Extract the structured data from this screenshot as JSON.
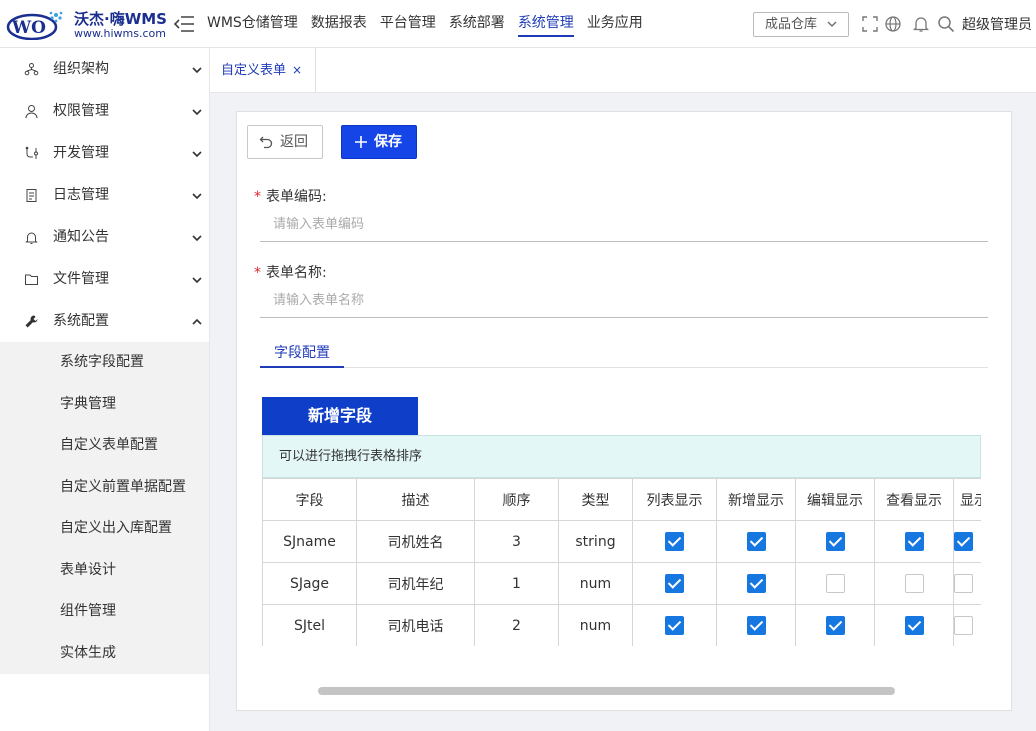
{
  "header": {
    "logo_title": "沃杰·嗨WMS",
    "logo_url": "www.hiwms.com",
    "nav": [
      {
        "label": "WMS仓储管理"
      },
      {
        "label": "数据报表"
      },
      {
        "label": "平台管理"
      },
      {
        "label": "系统部署"
      },
      {
        "label": "系统管理",
        "active": true
      },
      {
        "label": "业务应用"
      }
    ],
    "warehouse": "成品仓库",
    "user": "超级管理员"
  },
  "sidebar": {
    "items": [
      {
        "label": "组织架构",
        "icon": "org-icon",
        "expanded": false
      },
      {
        "label": "权限管理",
        "icon": "user-icon",
        "expanded": false
      },
      {
        "label": "开发管理",
        "icon": "dev-icon",
        "expanded": false
      },
      {
        "label": "日志管理",
        "icon": "log-icon",
        "expanded": false
      },
      {
        "label": "通知公告",
        "icon": "bell-icon",
        "expanded": false
      },
      {
        "label": "文件管理",
        "icon": "folder-icon",
        "expanded": false
      },
      {
        "label": "系统配置",
        "icon": "wrench-icon",
        "expanded": true
      }
    ],
    "subitems": [
      {
        "label": "系统字段配置"
      },
      {
        "label": "字典管理"
      },
      {
        "label": "自定义表单配置"
      },
      {
        "label": "自定义前置单据配置"
      },
      {
        "label": "自定义出入库配置"
      },
      {
        "label": "表单设计"
      },
      {
        "label": "组件管理"
      },
      {
        "label": "实体生成"
      }
    ]
  },
  "tabs": [
    {
      "label": "自定义表单",
      "close": "×"
    }
  ],
  "form": {
    "back_label": "返回",
    "save_label": "保存",
    "required_mark": "*",
    "code_label": "表单编码:",
    "code_value": "",
    "code_placeholder": "请输入表单编码",
    "name_label": "表单名称:",
    "name_value": "",
    "name_placeholder": "请输入表单名称",
    "subtab": "字段配置",
    "add_field": "新增字段",
    "hint": "可以进行拖拽行表格排序"
  },
  "table": {
    "columns": [
      "字段",
      "描述",
      "顺序",
      "类型",
      "列表显示",
      "新增显示",
      "编辑显示",
      "查看显示",
      "显示"
    ],
    "rows": [
      {
        "field": "SJname",
        "desc": "司机姓名",
        "order": "3",
        "type": "string",
        "checks": [
          true,
          true,
          true,
          true,
          true
        ]
      },
      {
        "field": "SJage",
        "desc": "司机年纪",
        "order": "1",
        "type": "num",
        "checks": [
          true,
          true,
          false,
          false,
          false
        ]
      },
      {
        "field": "SJtel",
        "desc": "司机电话",
        "order": "2",
        "type": "num",
        "checks": [
          true,
          true,
          true,
          true,
          false
        ]
      }
    ]
  },
  "colors": {
    "accent": "#1f3bb8",
    "primary_button": "#1545e6",
    "checkbox": "#1677e0",
    "required": "#e0242b"
  }
}
